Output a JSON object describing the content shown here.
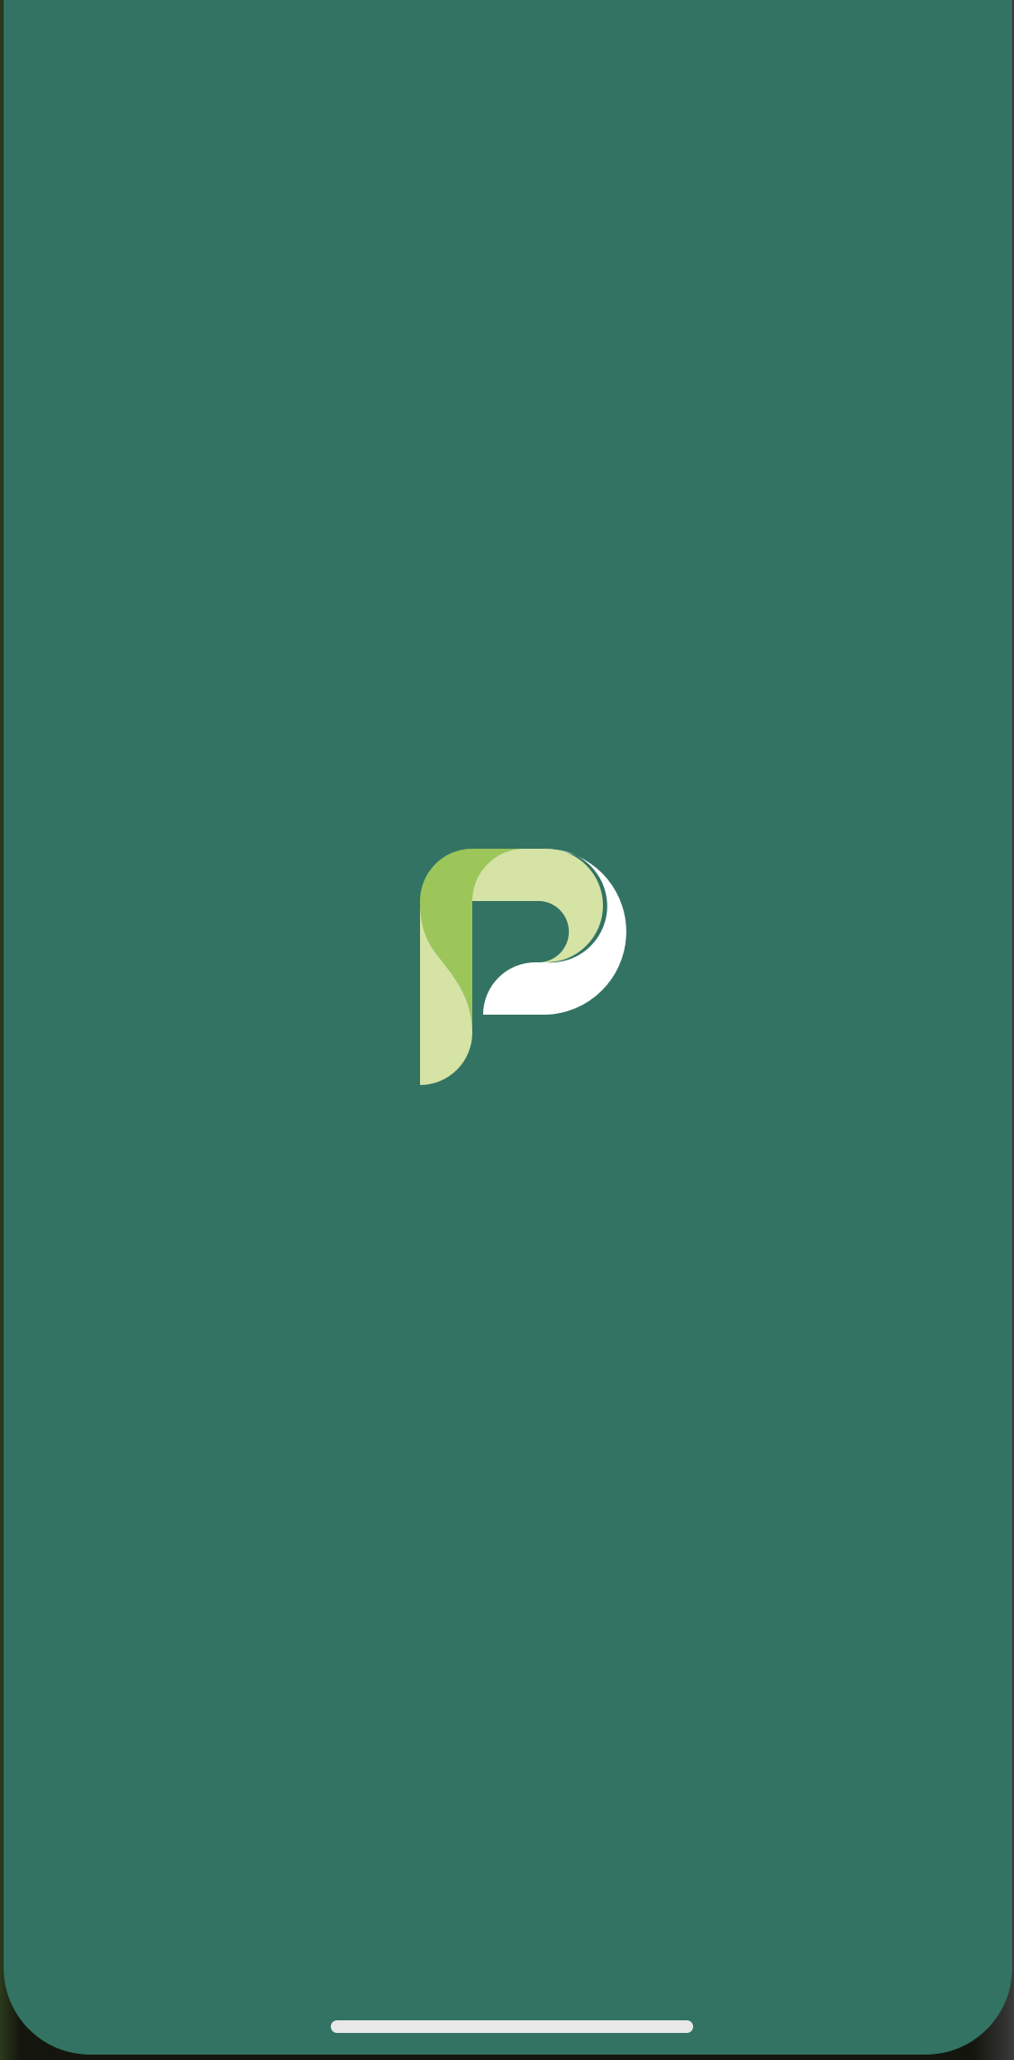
{
  "colors": {
    "screen_background": "#337363",
    "logo_dark_green": "#9cc65a",
    "logo_light_green": "#d5e3a5",
    "logo_white": "#ffffff",
    "home_indicator": "#e8e8e8"
  },
  "splash": {
    "logo_icon": "p-letter-logo-icon"
  },
  "system": {
    "home_indicator_icon": "home-indicator-bar"
  }
}
